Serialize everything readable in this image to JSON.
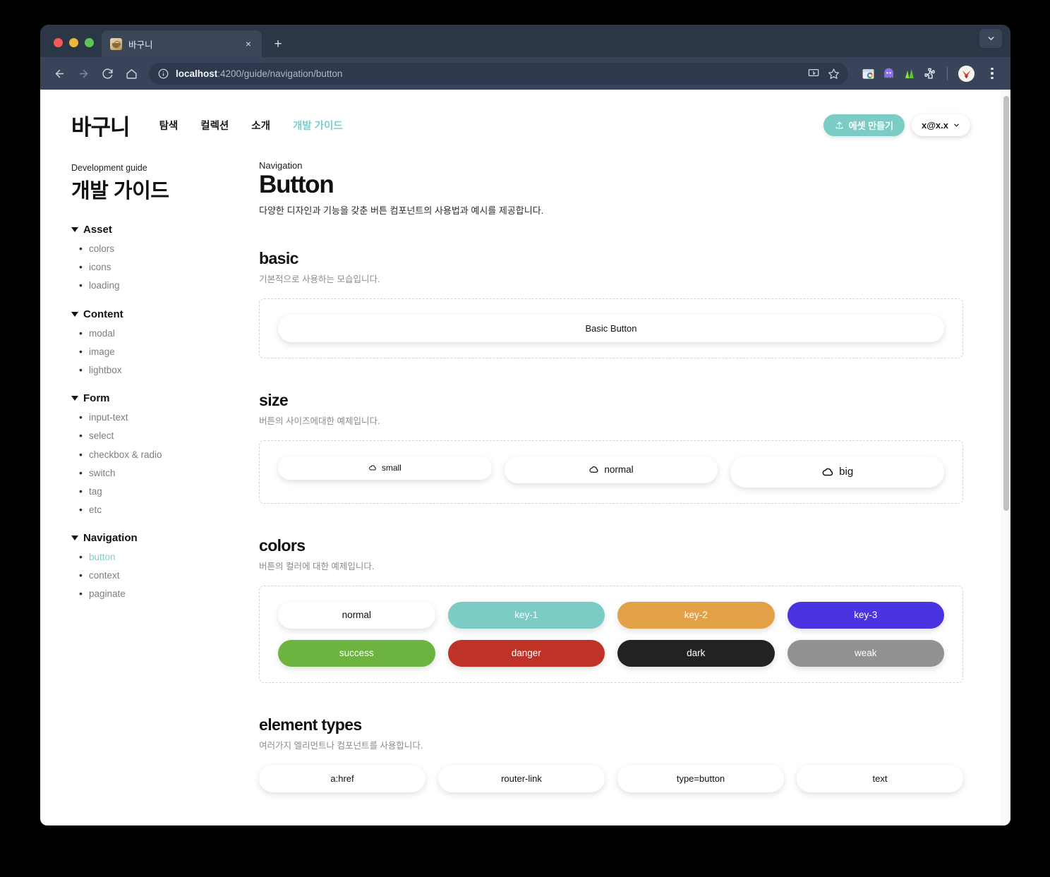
{
  "browser": {
    "tab": {
      "title": "바구니",
      "favicon": "basket-favicon",
      "close": "×"
    },
    "new_tab": "+",
    "window_caret": "chevron-down-icon",
    "toolbar": {
      "back": "back-arrow-icon",
      "forward": "forward-arrow-icon",
      "reload": "reload-icon",
      "home": "home-icon",
      "site_info": "info-circle-icon",
      "url_host": "localhost",
      "url_path": ":4200/guide/navigation/button",
      "install": "install-icon",
      "bookmark": "star-icon",
      "extensions": [
        "chrome-store-icon",
        "ghost-extension-icon",
        "analytics-extension-icon",
        "puzzle-extension-icon"
      ],
      "profile_avatar": "profile-avatar",
      "menu": "kebab-menu-icon"
    }
  },
  "site": {
    "brand": "바구니",
    "nav": [
      {
        "label": "탐색",
        "active": false
      },
      {
        "label": "컬렉션",
        "active": false
      },
      {
        "label": "소개",
        "active": false
      },
      {
        "label": "개발 가이드",
        "active": true
      }
    ],
    "create_button": {
      "label": "에셋 만들기",
      "icon": "upload-icon"
    },
    "account_button": {
      "label": "x@x.x",
      "icon": "chevron-down-icon"
    }
  },
  "sidebar": {
    "eyebrow": "Development guide",
    "title": "개발 가이드",
    "groups": [
      {
        "label": "Asset",
        "items": [
          {
            "label": "colors",
            "active": false
          },
          {
            "label": "icons",
            "active": false
          },
          {
            "label": "loading",
            "active": false
          }
        ]
      },
      {
        "label": "Content",
        "items": [
          {
            "label": "modal",
            "active": false
          },
          {
            "label": "image",
            "active": false
          },
          {
            "label": "lightbox",
            "active": false
          }
        ]
      },
      {
        "label": "Form",
        "items": [
          {
            "label": "input-text",
            "active": false
          },
          {
            "label": "select",
            "active": false
          },
          {
            "label": "checkbox & radio",
            "active": false
          },
          {
            "label": "switch",
            "active": false
          },
          {
            "label": "tag",
            "active": false
          },
          {
            "label": "etc",
            "active": false
          }
        ]
      },
      {
        "label": "Navigation",
        "items": [
          {
            "label": "button",
            "active": true
          },
          {
            "label": "context",
            "active": false
          },
          {
            "label": "paginate",
            "active": false
          }
        ]
      }
    ]
  },
  "doc": {
    "eyebrow": "Navigation",
    "title": "Button",
    "description": "다양한 디자인과 기능을 갖춘 버튼 컴포넌트의 사용법과 예시를 제공합니다.",
    "sections": [
      {
        "title": "basic",
        "description": "기본적으로 사용하는 모습입니다.",
        "buttons": [
          {
            "label": "Basic Button"
          }
        ]
      },
      {
        "title": "size",
        "description": "버튼의 사이즈에대한 예제입니다.",
        "buttons": [
          {
            "label": "small",
            "icon": "cloud-icon"
          },
          {
            "label": "normal",
            "icon": "cloud-icon"
          },
          {
            "label": "big",
            "icon": "cloud-icon"
          }
        ]
      },
      {
        "title": "colors",
        "description": "버튼의 컬러에 대한 예제입니다.",
        "buttons": [
          {
            "label": "normal",
            "bg": "#ffffff",
            "fg": "#111111"
          },
          {
            "label": "key-1",
            "bg": "#7bccc4",
            "fg": "#ffffff"
          },
          {
            "label": "key-2",
            "bg": "#e2a047",
            "fg": "#ffffff"
          },
          {
            "label": "key-3",
            "bg": "#4a33e0",
            "fg": "#ffffff"
          },
          {
            "label": "success",
            "bg": "#6cb33f",
            "fg": "#ffffff"
          },
          {
            "label": "danger",
            "bg": "#bf3228",
            "fg": "#ffffff"
          },
          {
            "label": "dark",
            "bg": "#222222",
            "fg": "#ffffff"
          },
          {
            "label": "weak",
            "bg": "#919191",
            "fg": "#ffffff"
          }
        ]
      },
      {
        "title": "element types",
        "description": "여러가지 엘리먼트나 컴포넌트를 사용합니다.",
        "buttons": [
          {
            "label": "a:href"
          },
          {
            "label": "router-link"
          },
          {
            "label": "type=button"
          },
          {
            "label": "text"
          }
        ]
      }
    ]
  }
}
